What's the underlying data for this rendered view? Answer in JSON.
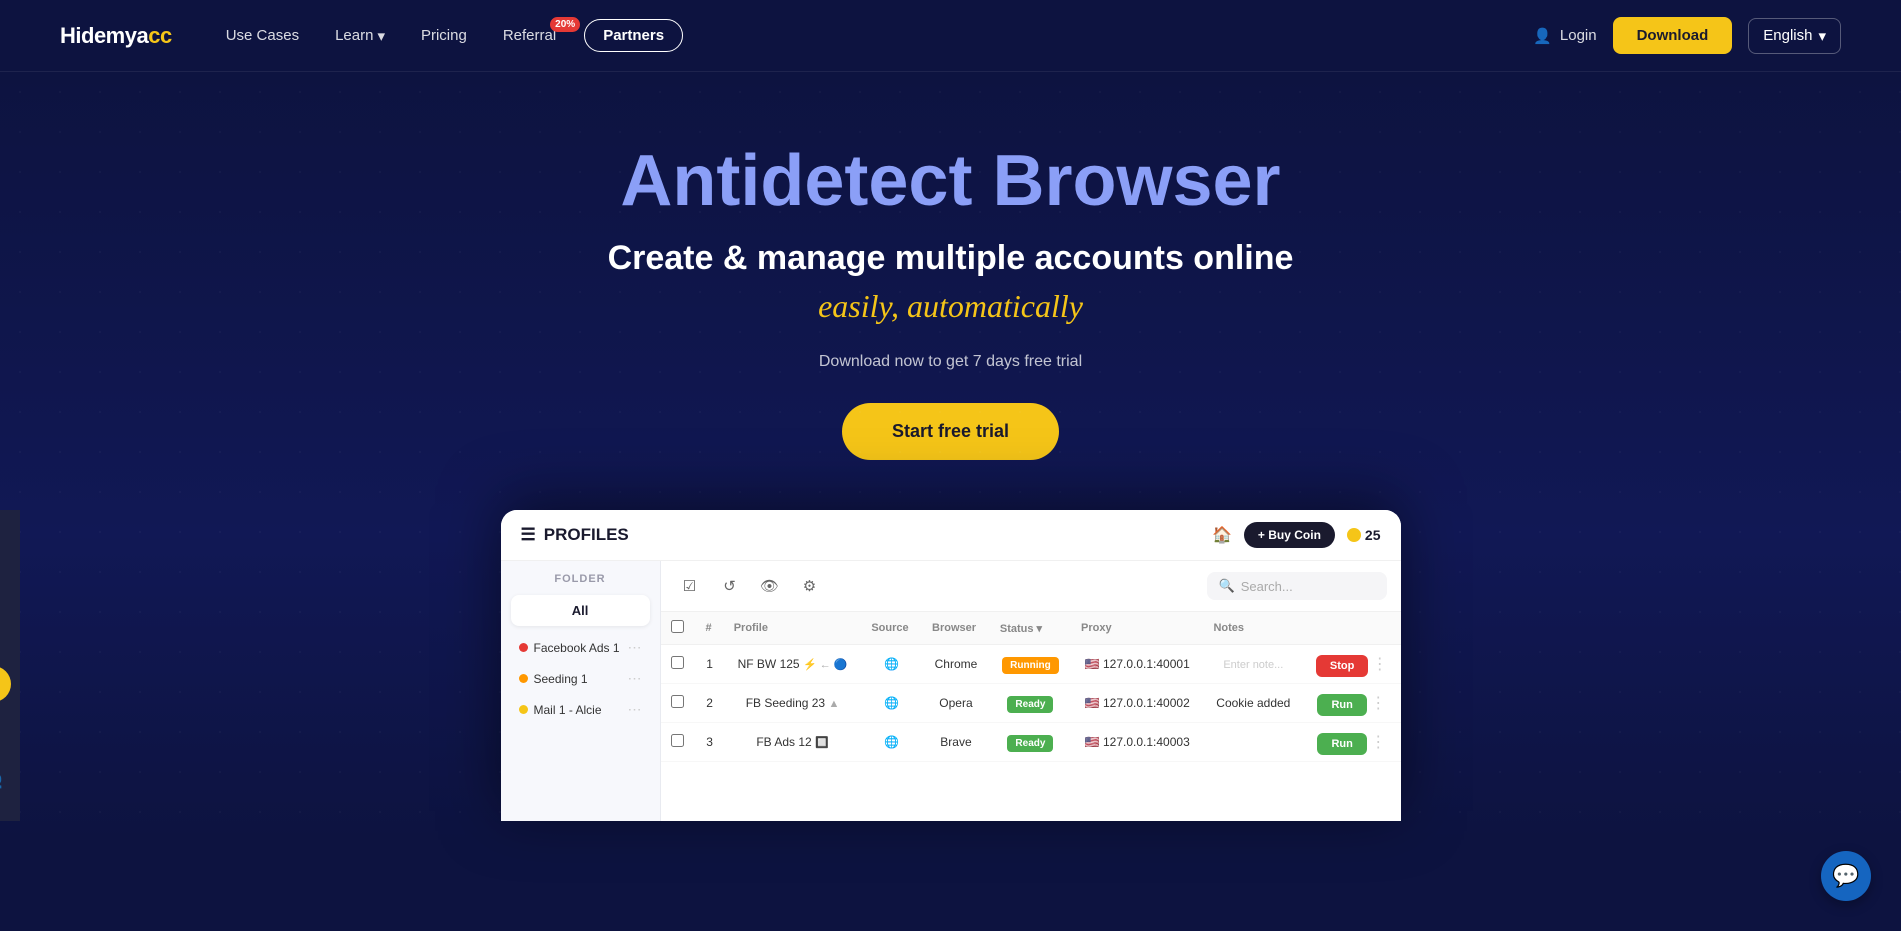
{
  "brand": {
    "name_part1": "Hidemya",
    "name_part2": "cc"
  },
  "nav": {
    "links": [
      {
        "id": "use-cases",
        "label": "Use Cases",
        "has_dropdown": false,
        "badge": null
      },
      {
        "id": "learn",
        "label": "Learn",
        "has_dropdown": true,
        "badge": null
      },
      {
        "id": "pricing",
        "label": "Pricing",
        "has_dropdown": false,
        "badge": null
      },
      {
        "id": "referral",
        "label": "Referral",
        "has_dropdown": false,
        "badge": "20%"
      },
      {
        "id": "partners",
        "label": "Partners",
        "has_dropdown": false,
        "badge": null,
        "outlined": true
      }
    ],
    "login_label": "Login",
    "download_label": "Download",
    "language_label": "English"
  },
  "hero": {
    "title": "Antidetect Browser",
    "subtitle": "Create & manage multiple accounts online",
    "cursive": "easily, automatically",
    "description": "Download now to get 7 days free trial",
    "cta_label": "Start free trial"
  },
  "app_preview": {
    "header": {
      "menu_icon": "☰",
      "title": "PROFILES",
      "home_icon": "🏠",
      "buy_coin_label": "+ Buy Coin",
      "coin_count": "25"
    },
    "folder_panel": {
      "section_label": "FOLDER",
      "all_label": "All",
      "folders": [
        {
          "name": "Facebook Ads 1",
          "color": "red"
        },
        {
          "name": "Seeding 1",
          "color": "orange"
        },
        {
          "name": "Mail 1 - Alcie",
          "color": "yellow"
        }
      ]
    },
    "table": {
      "toolbar_icons": [
        "✓",
        "↺",
        "👁",
        "⚙"
      ],
      "search_placeholder": "Search...",
      "columns": [
        "#",
        "Profile",
        "Source",
        "Browser",
        "Status",
        "Proxy",
        "Notes"
      ],
      "rows": [
        {
          "num": "1",
          "name": "NF BW 125",
          "icons": [
            "⚡",
            "←",
            "●"
          ],
          "source": "🌐",
          "browser": "Chrome",
          "status": "Running",
          "flag": "🇺🇸",
          "proxy": "127.0.0.1:40001",
          "note_placeholder": "Enter note...",
          "action": "Stop"
        },
        {
          "num": "2",
          "name": "FB Seeding 23",
          "icons": [
            "▲"
          ],
          "source": "🌐",
          "browser": "Opera",
          "status": "Ready",
          "flag": "🇺🇸",
          "proxy": "127.0.0.1:40002",
          "note": "Cookie added",
          "action": "Run"
        },
        {
          "num": "3",
          "name": "FB Ads 12",
          "icons": [
            "🔲"
          ],
          "source": "🌐",
          "browser": "Brave",
          "status": "Ready",
          "flag": "🇺🇸",
          "proxy": "127.0.0.1:40003",
          "note": "",
          "action": "Run"
        }
      ]
    }
  },
  "chat": {
    "icon_label": "💬"
  },
  "colors": {
    "bg_dark": "#0d1340",
    "accent_yellow": "#f5c518",
    "accent_blue": "#8b9ff7",
    "nav_download": "#f5c518"
  }
}
